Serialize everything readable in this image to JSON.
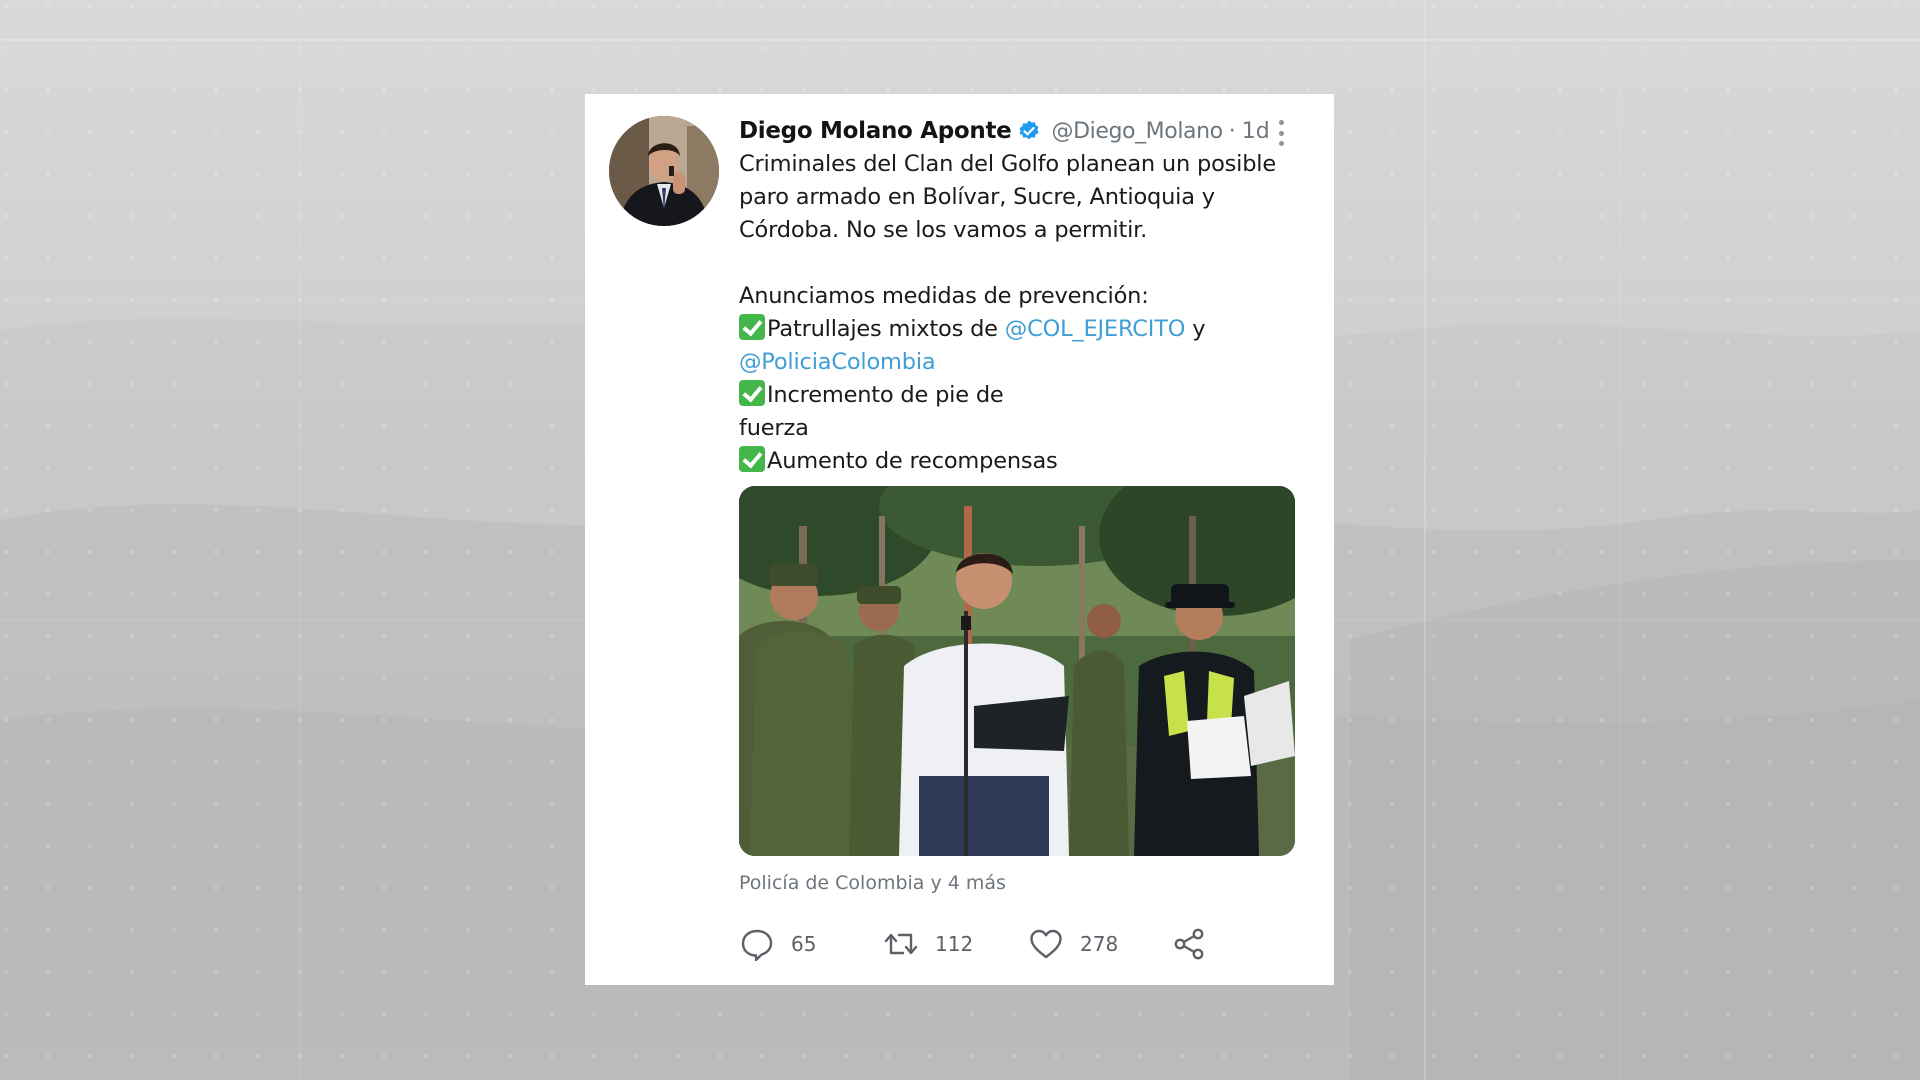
{
  "tweet": {
    "author_name": "Diego Molano Aponte",
    "handle": "@Diego_Molano",
    "separator": "·",
    "time": "1d",
    "body": {
      "line1": "Criminales del Clan del Golfo planean un posible",
      "line2": "paro armado en Bolívar, Sucre, Antioquia y",
      "line3": "Córdoba. No se los vamos a permitir.",
      "intro": "Anunciamos medidas de prevención:",
      "item1_text": "Patrullajes mixtos de ",
      "item1_mention1": "@COL_EJERCITO",
      "item1_conjunction": " y",
      "item1_mention2": "@PoliciaColombia",
      "item2_line1": "Incremento de pie de",
      "item2_line2": "fuerza",
      "item3_text": "Aumento de recompensas"
    },
    "tagged": "Policía de Colombia y 4 más",
    "actions": {
      "replies": "65",
      "retweets": "112",
      "likes": "278"
    },
    "icons": {
      "verified": "verified-badge-icon",
      "more": "more-options-icon",
      "check": "check-mark-icon",
      "reply": "reply-icon",
      "retweet": "retweet-icon",
      "like": "heart-icon",
      "share": "share-icon"
    },
    "colors": {
      "mention": "#3f9fd5",
      "verified": "#1d9bf0",
      "check": "#44b64a",
      "muted": "#6e767d"
    }
  }
}
